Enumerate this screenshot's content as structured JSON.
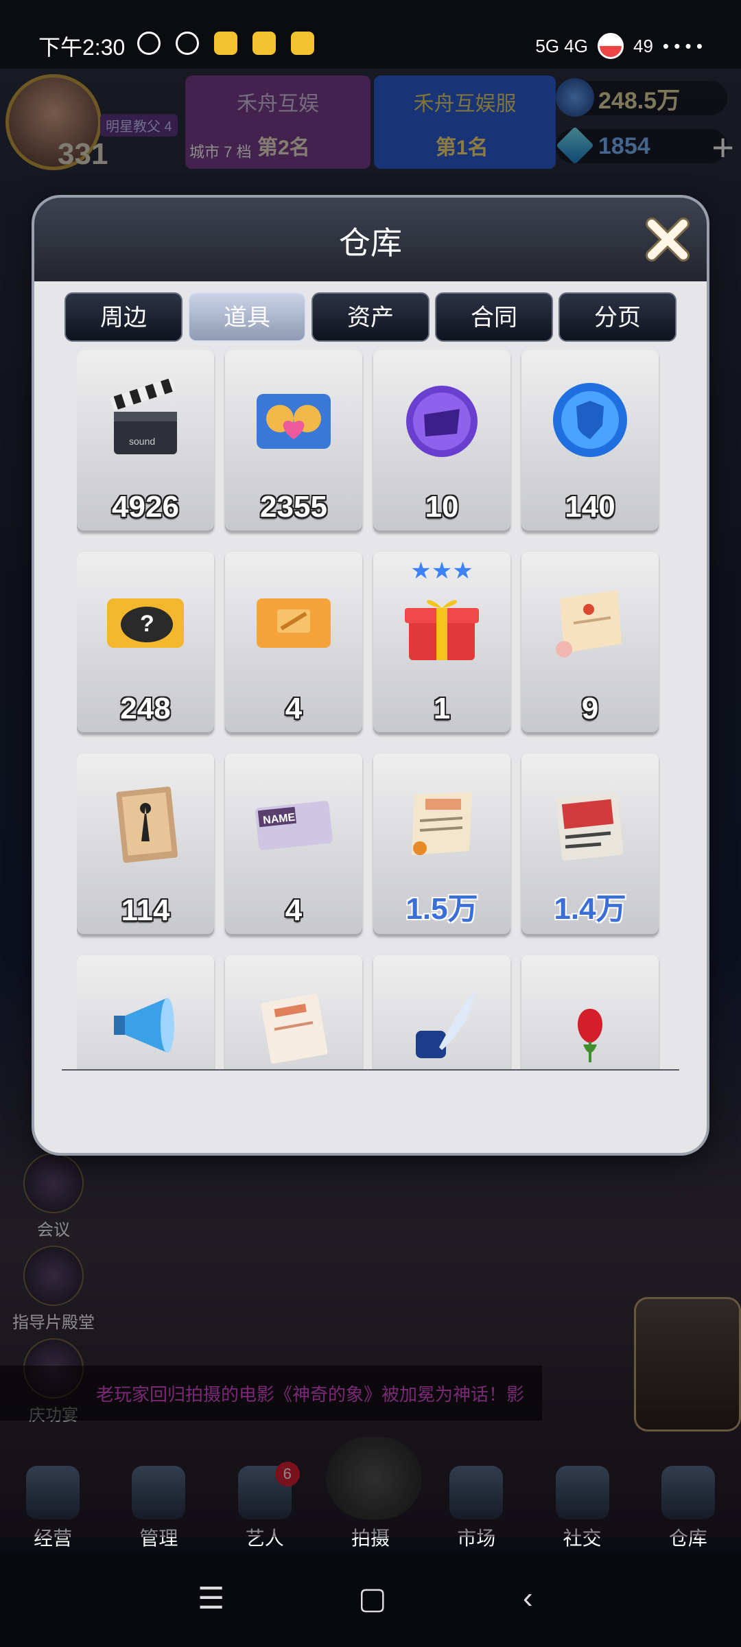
{
  "status_bar": {
    "time": "下午2:30",
    "network": "5G 4G",
    "battery": "49",
    "more": "• • • •"
  },
  "hud": {
    "player_title": "明星教父 4",
    "level": "331",
    "company_a": {
      "name": "禾舟互娱",
      "rank": "第2名",
      "city_label": "城市 7 档"
    },
    "company_b": {
      "name": "禾舟互娱服",
      "rank": "第1名"
    },
    "coins": "248.5万",
    "gems": "1854",
    "plus_label": "+"
  },
  "modal": {
    "title": "仓库",
    "tabs": [
      {
        "label": "周边"
      },
      {
        "label": "道具"
      },
      {
        "label": "资产"
      },
      {
        "label": "合同"
      },
      {
        "label": "分页"
      }
    ],
    "active_tab": "道具",
    "items": [
      {
        "icon": "clapperboard-icon",
        "qty": "4926"
      },
      {
        "icon": "couple-card-icon",
        "qty": "2355"
      },
      {
        "icon": "purple-ticket-coin-icon",
        "qty": "10"
      },
      {
        "icon": "blue-shield-orb-icon",
        "qty": "140"
      },
      {
        "icon": "mystery-card-icon",
        "qty": "248"
      },
      {
        "icon": "orange-card-icon",
        "qty": "4"
      },
      {
        "icon": "gift-box-icon",
        "qty": "1",
        "stars": "★★★"
      },
      {
        "icon": "scroll-icon",
        "qty": "9"
      },
      {
        "icon": "movie-poster-icon",
        "qty": "114"
      },
      {
        "icon": "name-card-icon",
        "qty": "4"
      },
      {
        "icon": "work-letter-icon",
        "qty": "1.5万"
      },
      {
        "icon": "red-document-icon",
        "qty": "1.4万"
      },
      {
        "icon": "megaphone-icon",
        "qty": ""
      },
      {
        "icon": "certificate-icon",
        "qty": ""
      },
      {
        "icon": "ink-quill-icon",
        "qty": ""
      },
      {
        "icon": "rose-icon",
        "qty": ""
      }
    ]
  },
  "side_buttons": {
    "meeting": "会议",
    "hall": "指导片殿堂",
    "party": "庆功宴"
  },
  "marquee": "老玩家回归拍摄的电影《神奇的象》被加冕为神话！影",
  "bottom_nav": [
    {
      "label": "经营",
      "badge": ""
    },
    {
      "label": "管理",
      "badge": ""
    },
    {
      "label": "艺人",
      "badge": "6"
    },
    {
      "label": "拍摄",
      "badge": ""
    },
    {
      "label": "市场",
      "badge": ""
    },
    {
      "label": "社交",
      "badge": ""
    },
    {
      "label": "仓库",
      "badge": ""
    }
  ],
  "system_nav": {
    "menu": "☰",
    "home": "▢",
    "back": "‹"
  }
}
